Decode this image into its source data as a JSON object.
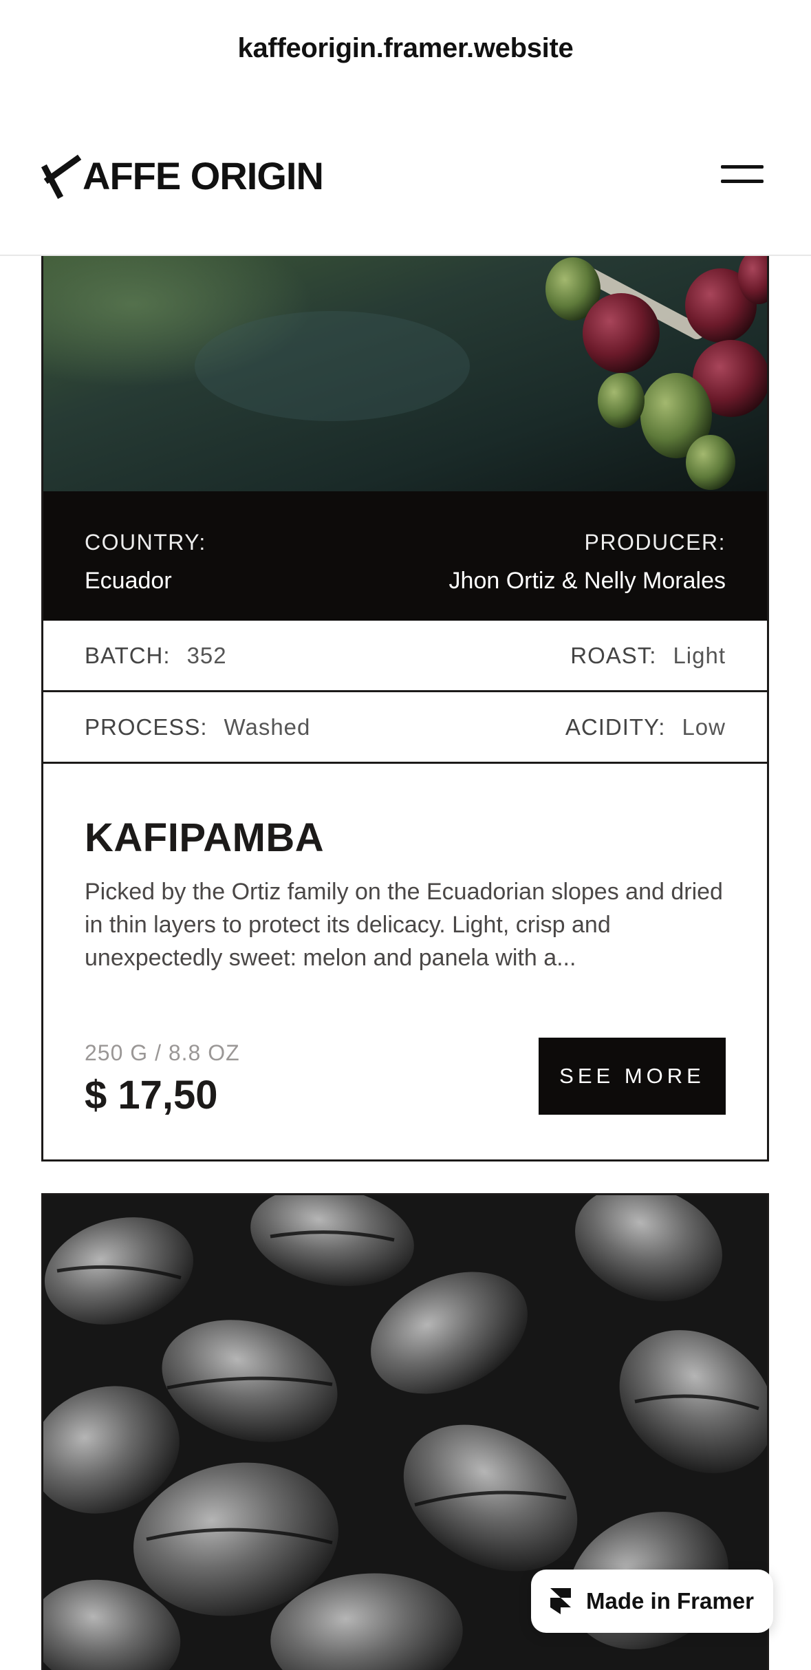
{
  "browser": {
    "url": "kaffeorigin.framer.website"
  },
  "header": {
    "logo_text": "AFFE ORIGIN",
    "logo_alt": "KAFFE ORIGIN",
    "menu_icon": "hamburger-icon"
  },
  "product": {
    "country_label": "COUNTRY:",
    "country": "Ecuador",
    "producer_label": "PRODUCER:",
    "producer": "Jhon Ortiz & Nelly Morales",
    "batch_label": "BATCH:",
    "batch": "352",
    "roast_label": "ROAST:",
    "roast": "Light",
    "process_label": "PROCESS:",
    "process": "Washed",
    "acidity_label": "ACIDITY:",
    "acidity": "Low",
    "name": "KAFIPAMBA",
    "description": "Picked by the Ortiz family on the Ecuadorian slopes and dried in thin layers to protect its delicacy. Light, crisp and unexpectedly sweet: melon and panela with a...",
    "weight": "250 G / 8.8 OZ",
    "price": "$ 17,50",
    "cta": "SEE MORE"
  },
  "badge": {
    "label": "Made in Framer",
    "icon": "framer-icon"
  },
  "colors": {
    "ink": "#1c1a19",
    "dark": "#0d0b0a",
    "muted": "#9a9796"
  }
}
